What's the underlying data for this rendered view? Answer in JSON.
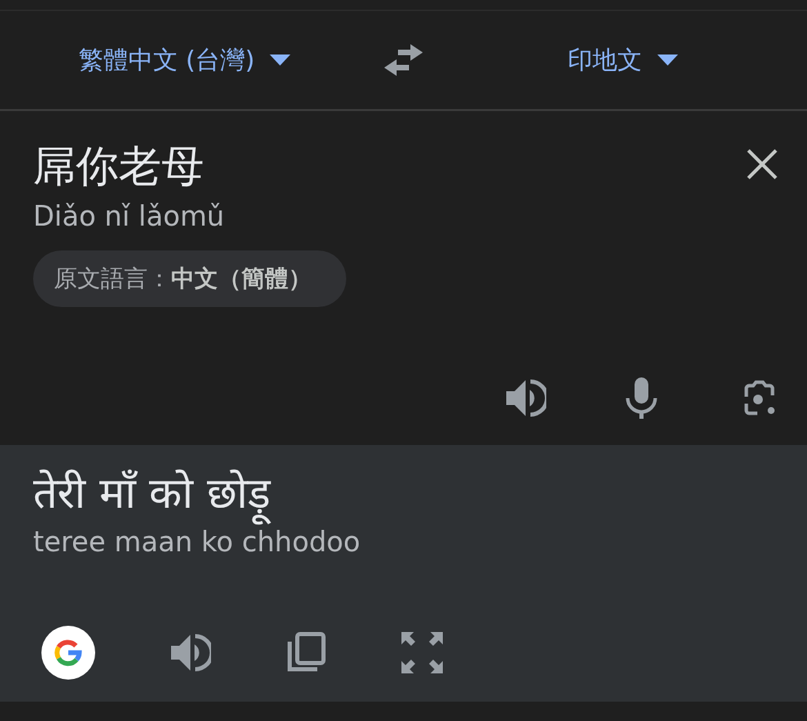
{
  "language_bar": {
    "source_language": "繁體中文 (台灣)",
    "target_language": "印地文"
  },
  "input": {
    "text": "屌你老母",
    "romanization": "Diǎo nǐ lǎomǔ",
    "detected_language": "原文語言：**中文（簡體）**"
  },
  "result": {
    "text": "तेरी माँ को छोड़ू",
    "romanization": "teree maan ko chhodoo"
  }
}
